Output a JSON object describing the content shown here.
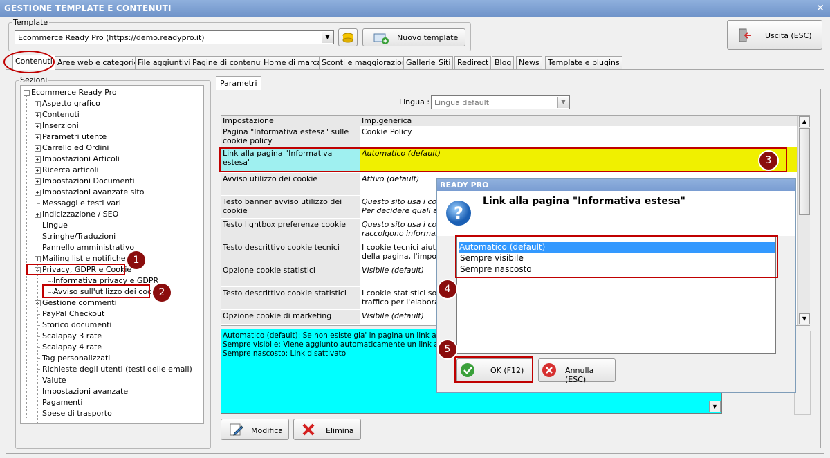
{
  "window": {
    "title": "GESTIONE TEMPLATE E CONTENUTI",
    "close": "✕"
  },
  "template": {
    "group_label": "Template",
    "selected": "Ecommerce Ready Pro (https://demo.readypro.it)",
    "new_button": "Nuovo template",
    "exit_button": "Uscita (ESC)"
  },
  "tabs": [
    "Contenuti",
    "Aree web e categorie",
    "File aggiuntivi",
    "Pagine di contenuti",
    "Home di marca",
    "Sconti e maggiorazioni",
    "Gallerie",
    "Siti",
    "Redirect",
    "Blog",
    "News",
    "Template e plugins"
  ],
  "sections": {
    "label": "Sezioni",
    "root": "Ecommerce Ready Pro",
    "items": [
      {
        "label": "Aspetto grafico",
        "expand": true
      },
      {
        "label": "Contenuti",
        "expand": true
      },
      {
        "label": "Inserzioni",
        "expand": true
      },
      {
        "label": "Parametri utente",
        "expand": true
      },
      {
        "label": "Carrello ed Ordini",
        "expand": true
      },
      {
        "label": "Impostazioni Articoli",
        "expand": true
      },
      {
        "label": "Ricerca articoli",
        "expand": true
      },
      {
        "label": "Impostazioni Documenti",
        "expand": true
      },
      {
        "label": "Impostazioni avanzate sito",
        "expand": true
      },
      {
        "label": "Messaggi e testi vari",
        "expand": false
      },
      {
        "label": "Indicizzazione / SEO",
        "expand": true
      },
      {
        "label": "Lingue",
        "expand": false
      },
      {
        "label": "Stringhe/Traduzioni",
        "expand": false
      },
      {
        "label": "Pannello amministrativo",
        "expand": false
      },
      {
        "label": "Mailing list e notifiche ema",
        "expand": true
      },
      {
        "label": "Privacy, GDPR e Cookie",
        "expand": true,
        "open": true
      },
      {
        "label": "Informativa privacy e GDPR",
        "child": true
      },
      {
        "label": "Avviso sull'utilizzo dei cookie",
        "child": true
      },
      {
        "label": "Gestione commenti",
        "expand": true
      },
      {
        "label": "PayPal Checkout",
        "expand": false
      },
      {
        "label": "Storico documenti",
        "expand": false
      },
      {
        "label": "Scalapay 3 rate",
        "expand": false
      },
      {
        "label": "Scalapay 4 rate",
        "expand": false
      },
      {
        "label": "Tag personalizzati",
        "expand": false
      },
      {
        "label": "Richieste degli utenti (testi delle email)",
        "expand": false
      },
      {
        "label": "Valute",
        "expand": false
      },
      {
        "label": "Impostazioni avanzate",
        "expand": false
      },
      {
        "label": "Pagamenti",
        "expand": false
      },
      {
        "label": "Spese di trasporto",
        "expand": false
      }
    ]
  },
  "params": {
    "tab": "Parametri",
    "language_label": "Lingua :",
    "language_value": "Lingua default",
    "headers": [
      "Impostazione",
      "Imp.generica"
    ],
    "rows": [
      {
        "k": "Pagina \"Informativa estesa\" sulle cookie policy",
        "v": "Cookie Policy",
        "italic": false
      },
      {
        "k": "Link alla pagina \"Informativa estesa\"",
        "v": "Automatico (default)",
        "italic": true
      },
      {
        "k": "Avviso utilizzo dei cookie",
        "v": "Attivo (default)",
        "italic": true
      },
      {
        "k": "Testo banner avviso utilizzo dei cookie",
        "v": "Questo sito usa i cooki\nPer decidere quali acco",
        "italic": true
      },
      {
        "k": "Testo lightbox preferenze cookie",
        "v": "Questo sito usa i cooki\nraccolgono informazion",
        "italic": true
      },
      {
        "k": "Testo descrittivo cookie tecnici",
        "v": "I cookie tecnici aiutano\ndella pagina, l'impostaz",
        "italic": false
      },
      {
        "k": "Opzione cookie statistici",
        "v": "Visibile (default)",
        "italic": true
      },
      {
        "k": "Testo descrittivo cookie statistici",
        "v": "I cookie statistici sono\ntraffico per l'elaborazio",
        "italic": false
      },
      {
        "k": "Opzione cookie di marketing",
        "v": "Visibile (default)",
        "italic": true
      }
    ],
    "description": "Automatico (default): Se non esiste gia' in pagina un link all'inform\nSempre visibile: Viene aggiunto automaticamente un link alla infor\nSempre nascosto: Link disattivato",
    "edit_button": "Modifica",
    "delete_button": "Elimina"
  },
  "dialog": {
    "title": "READY PRO",
    "question": "Link alla pagina \"Informativa estesa\"",
    "options": [
      "Automatico (default)",
      "Sempre visibile",
      "Sempre nascosto"
    ],
    "selected_index": 0,
    "ok": "OK (F12)",
    "cancel": "Annulla (ESC)"
  },
  "badges": [
    "1",
    "2",
    "3",
    "4",
    "5"
  ],
  "colors": {
    "highlight_row": "#f0f000",
    "key_highlight": "#9ff0f0",
    "description_bg": "#00ffff",
    "annotation_red": "#c00000",
    "badge": "#8b0d0d",
    "selection": "#3399ff"
  }
}
